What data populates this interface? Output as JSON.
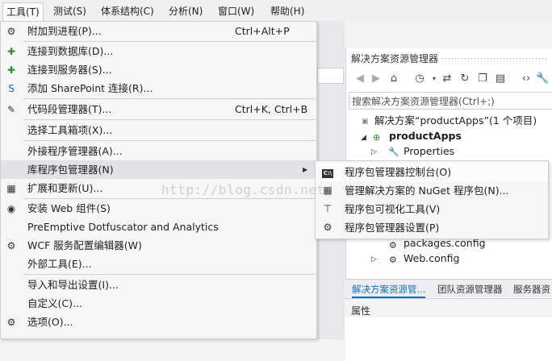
{
  "menubar": {
    "items": [
      {
        "label": "工具(T)",
        "active": true
      },
      {
        "label": "测试(S)"
      },
      {
        "label": "体系结构(C)"
      },
      {
        "label": "分析(N)"
      },
      {
        "label": "窗口(W)"
      },
      {
        "label": "帮助(H)"
      }
    ]
  },
  "tools_menu": {
    "items": [
      {
        "label": "附加到进程(P)...",
        "shortcut": "Ctrl+Alt+P",
        "icon": "attach-process-icon"
      },
      {
        "label": "连接到数据库(D)...",
        "icon": "connect-database-icon"
      },
      {
        "label": "连接到服务器(S)...",
        "icon": "connect-server-icon"
      },
      {
        "label": "添加 SharePoint 连接(R)...",
        "icon": "sharepoint-icon"
      },
      {
        "label": "代码段管理器(T)...",
        "shortcut": "Ctrl+K, Ctrl+B",
        "icon": "code-snippet-icon"
      },
      {
        "label": "选择工具箱项(X)..."
      },
      {
        "label": "外接程序管理器(A)..."
      },
      {
        "label": "库程序包管理器(N)",
        "highlighted": true,
        "submenu": true
      },
      {
        "label": "扩展和更新(U)...",
        "icon": "extensions-icon"
      },
      {
        "label": "安装 Web 组件(S)",
        "icon": "web-components-icon"
      },
      {
        "label": "PreEmptive Dotfuscator and Analytics"
      },
      {
        "label": "WCF 服务配置编辑器(W)",
        "icon": "wcf-config-icon"
      },
      {
        "label": "外部工具(E)..."
      },
      {
        "label": "导入和导出设置(I)..."
      },
      {
        "label": "自定义(C)..."
      },
      {
        "label": "选项(O)...",
        "icon": "options-gear-icon"
      }
    ]
  },
  "submenu": {
    "items": [
      {
        "label": "程序包管理器控制台(O)",
        "icon": "console-icon",
        "highlighted": true
      },
      {
        "label": "管理解决方案的 NuGet 程序包(N)...",
        "icon": "nuget-package-icon"
      },
      {
        "label": "程序包可视化工具(V)",
        "icon": "visualizer-icon"
      },
      {
        "label": "程序包管理器设置(P)",
        "icon": "settings-gear-icon"
      }
    ]
  },
  "solution_explorer": {
    "title": "解决方案资源管理器",
    "search_placeholder": "搜索解决方案资源管理器(Ctrl+;)",
    "tree": [
      {
        "label": "解决方案“productApps”(1 个项目)"
      },
      {
        "label": "productApps",
        "bold": true
      },
      {
        "label": "Properties"
      },
      {
        "label": "packages.config"
      },
      {
        "label": "Web.config"
      }
    ],
    "tabs": [
      "解决方案资源管...",
      "团队资源管理器",
      "服务器资"
    ],
    "properties_title": "属性"
  },
  "watermark": "http://blog.csdn.net/",
  "colors": {
    "highlight": "#e2e2e6",
    "accent": "#0e70c0"
  }
}
